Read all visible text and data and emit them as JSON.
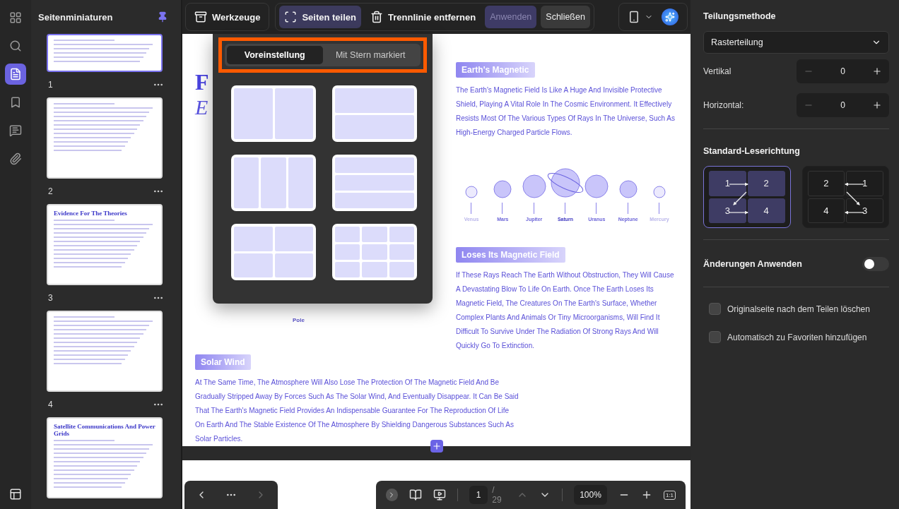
{
  "rail": {
    "items": [
      {
        "kind": "apps",
        "selected": false
      },
      {
        "kind": "search",
        "selected": false
      },
      {
        "kind": "pages",
        "selected": true
      },
      {
        "kind": "bookmark",
        "selected": false
      },
      {
        "kind": "comment",
        "selected": false
      },
      {
        "kind": "attachment",
        "selected": false
      }
    ]
  },
  "sidebar": {
    "title": "Seitenminiaturen",
    "thumbnails": [
      {
        "label": "1",
        "selected": true
      },
      {
        "label": "2",
        "selected": false
      },
      {
        "label": "3",
        "selected": false,
        "title": "Evidence For The Theories"
      },
      {
        "label": "4",
        "selected": false
      },
      {
        "selected": false,
        "title": "Satellite Communications And Power Grids"
      }
    ]
  },
  "toolbar": {
    "tools": "Werkzeuge",
    "actions": [
      {
        "label": "Seiten teilen",
        "selected": true
      },
      {
        "label": "Trennlinie entfernen",
        "selected": false
      }
    ],
    "apply": {
      "label": "Anwenden",
      "disabled": true
    },
    "close": "Schließen"
  },
  "popup": {
    "tabs": [
      {
        "label": "Voreinstellung",
        "selected": true
      },
      {
        "label": "Mit Stern markiert",
        "selected": false
      }
    ],
    "presets": [
      {
        "kind": "cols2"
      },
      {
        "kind": "rows2"
      },
      {
        "kind": "cols3"
      },
      {
        "kind": "rows3"
      },
      {
        "kind": "grid2"
      },
      {
        "kind": "grid3"
      }
    ]
  },
  "document": {
    "heading_1": "F",
    "heading_2": "E",
    "pole_label": "Pole",
    "sections": [
      {
        "title": "Earth's Magnetic",
        "body": "The Earth's Magnetic Field Is Like A Huge And Invisible Protective Shield, Playing A Vital Role In The Cosmic Environment. It Effectively Resists Most Of The Various Types Of Rays In The Universe, Such As High-Energy Charged Particle Flows."
      },
      {
        "title": "Loses Its Magnetic Field",
        "body": "If These Rays Reach The Earth Without Obstruction, They Will Cause A Devastating Blow To Life On Earth. Once The Earth Loses Its Magnetic Field, The Creatures On The Earth's Surface, Whether Complex Plants And Animals Or Tiny Microorganisms, Will Find It Difficult To Survive Under The Radiation Of Strong Rays And Will Quickly Go To Extinction."
      },
      {
        "title": "Solar Wind",
        "body": "At The Same Time, The Atmosphere Will Also Lose The Protection Of The Magnetic Field And Be Gradually Stripped Away By Forces Such As The Solar Wind, And Eventually Disappear. It Can Be Said That The Earth's Magnetic Field Provides An Indispensable Guarantee For The Reproduction Of Life On Earth And The Stable Existence Of The Atmosphere By Shielding Dangerous Substances Such As Solar Particles."
      }
    ],
    "planets": [
      "Venus",
      "Mars",
      "Jupiter",
      "Saturn",
      "Uranus",
      "Neptune",
      "Mercury"
    ]
  },
  "navigation": {
    "page": "1",
    "total": "/ 29",
    "zoom": "100%",
    "actual_size": "1:1"
  },
  "panel": {
    "title": "Teilungsmethode",
    "method": "Rasterteilung",
    "steppers": [
      {
        "label": "Vertikal",
        "value": "0"
      },
      {
        "label": "Horizontal:",
        "value": "0"
      }
    ],
    "direction_title": "Standard-Leserichtung",
    "directions": [
      {
        "kind": "ltr",
        "selected": true,
        "cells": [
          "1",
          "2",
          "3",
          "4"
        ]
      },
      {
        "kind": "rtl",
        "selected": false,
        "cells": [
          "2",
          "1",
          "4",
          "3"
        ]
      }
    ],
    "apply_changes": {
      "label": "Änderungen Anwenden",
      "on": false
    },
    "checkboxes": [
      {
        "label": "Originalseite nach dem Teilen löschen",
        "checked": false
      },
      {
        "label": "Automatisch zu Favoriten hinzufügen",
        "checked": false
      }
    ]
  }
}
